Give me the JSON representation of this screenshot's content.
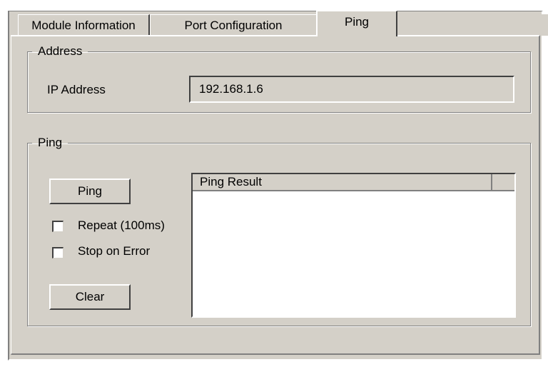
{
  "tabs": [
    {
      "label": "Module Information",
      "active": false
    },
    {
      "label": "Port Configuration",
      "active": false
    },
    {
      "label": "Ping",
      "active": true
    }
  ],
  "address_group": {
    "legend": "Address",
    "ip_label": "IP Address",
    "ip_value": "192.168.1.6"
  },
  "ping_group": {
    "legend": "Ping",
    "ping_button": "Ping",
    "repeat_label": "Repeat (100ms)",
    "repeat_checked": false,
    "stop_on_error_label": "Stop on Error",
    "stop_on_error_checked": false,
    "clear_button": "Clear",
    "result_header": "Ping Result",
    "results": []
  },
  "colors": {
    "dialog_bg": "#d4d0c8",
    "field_bg": "#ffffff"
  }
}
